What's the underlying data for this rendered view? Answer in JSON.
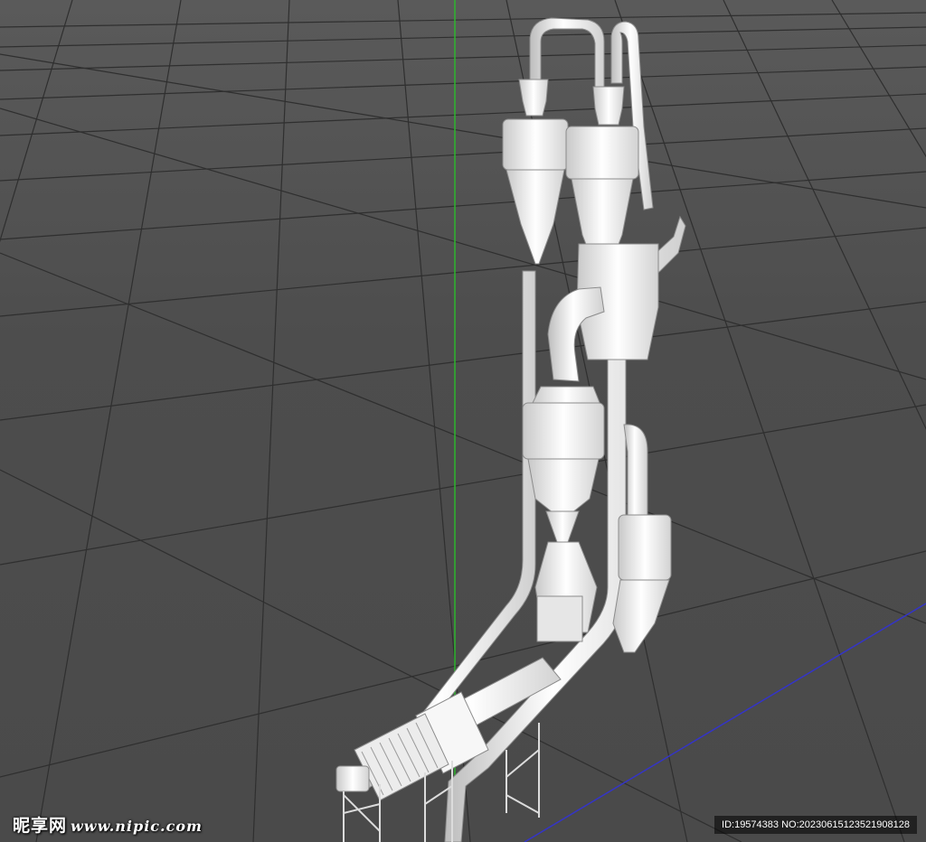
{
  "viewport": {
    "background": "#4a4a4a",
    "grid_color": "#2f2f2f",
    "y_axis_color": "#2db52d",
    "z_axis_color": "#3434c8",
    "model_color": "#f2f2f2"
  },
  "watermark_left": {
    "site": "昵享网",
    "url": "www.nipic.com"
  },
  "watermark_right": {
    "text": "ID:19574383 NO:20230615123521908128"
  }
}
